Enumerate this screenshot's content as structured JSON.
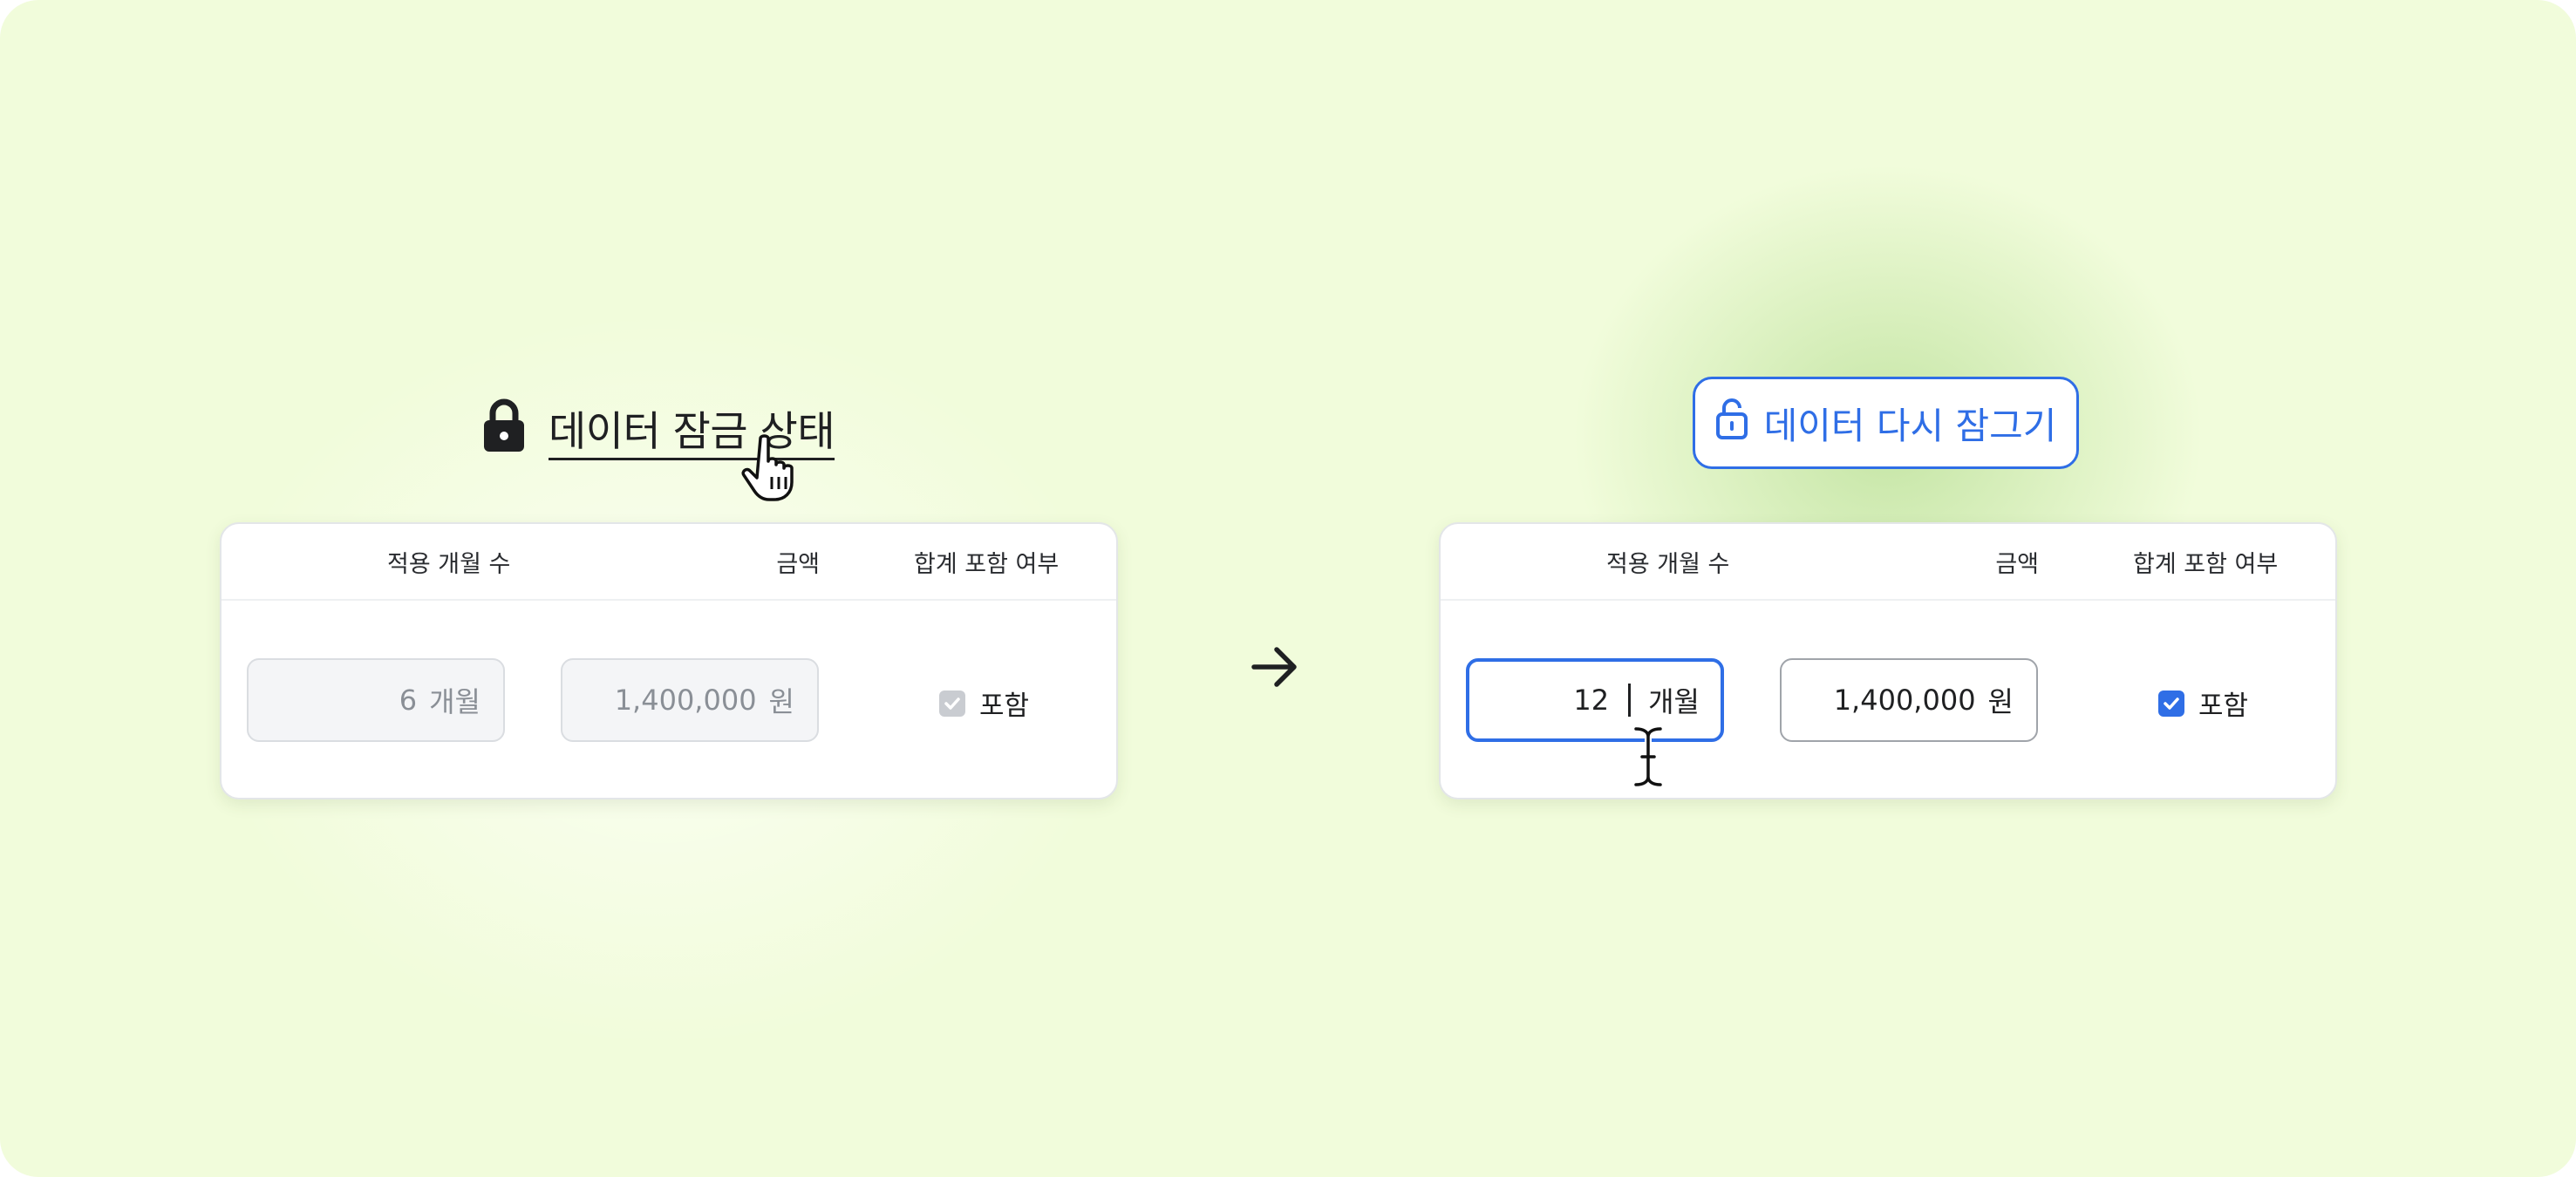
{
  "colors": {
    "background": "#f1fcdb",
    "accent": "#2f6ee6",
    "text": "#1f2022",
    "disabled_text": "#8a8f96"
  },
  "locked_state": {
    "status_icon": "lock-icon",
    "status_label": "데이터 잠금 상태",
    "table": {
      "headers": {
        "months": "적용 개월 수",
        "amount": "금액",
        "include": "합계 포함 여부"
      },
      "months_value": "6",
      "months_unit": "개월",
      "amount_value": "1,400,000",
      "amount_unit": "원",
      "include_label": "포함",
      "include_checked": true,
      "editable": false
    }
  },
  "transition_icon": "arrow-right-icon",
  "unlocked_state": {
    "relock_icon": "unlock-icon",
    "relock_label": "데이터 다시 잠그기",
    "table": {
      "headers": {
        "months": "적용 개월 수",
        "amount": "금액",
        "include": "합계 포함 여부"
      },
      "months_value": "12",
      "months_unit": "개월",
      "amount_value": "1,400,000",
      "amount_unit": "원",
      "include_label": "포함",
      "include_checked": true,
      "editable": true
    }
  }
}
